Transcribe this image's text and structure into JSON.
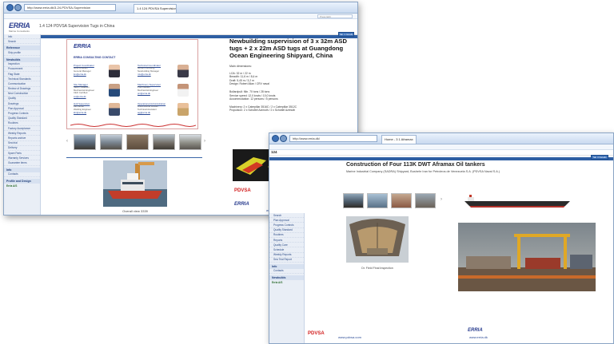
{
  "window_a": {
    "address": "http://www.erria.dk/3-24-PDVSA-Supervision",
    "tab_label": "1.4 124 PDVSA Supervision Tugs in China",
    "search_placeholder": "Press Edit",
    "logo": "ERRIA",
    "logo_sub": "Marine Consultants",
    "page_heading": "1.4 124 PDVSA Supervision Tugs in China",
    "top_button": "Tab 1 Details",
    "sidebar": {
      "top_items": [
        "Info",
        "Search"
      ],
      "section1": "Reference",
      "section1_items": [
        "Ship profile"
      ],
      "section2": "Newbuilds",
      "section2_items": [
        "Inspection",
        "Procurement",
        "Flag State",
        "Technical Standards",
        "Communication",
        "Review of Drawings",
        "New Construction",
        "Quality",
        "Drawings",
        "Plan Approval",
        "Progress Controls",
        "Quality Standard",
        "Routines",
        "Factory Acceptance",
        "Weekly Reports",
        "Reports archive",
        "Sea trial",
        "Delivery",
        "Spare Parts",
        "Warranty Services",
        "Guarantee items"
      ],
      "section3": "Info",
      "section3_items": [
        "Contacts"
      ],
      "section4": "Profile and Design",
      "note": "Erria A/S"
    },
    "contact_card": {
      "logo": "ERRIA",
      "title": "ERRIA CONSULTING CONTACT",
      "contacts": [
        {
          "role": "Project Coordinator",
          "lines": [
            "Jens Knudsen",
            "General Manager"
          ],
          "mail": "jkn@erria.dk"
        },
        {
          "role": "Technical Coordinator",
          "lines": [
            "Morten Lundberg",
            "Newbuilding Manager"
          ],
          "mail": "mlu@erria.dk"
        },
        {
          "role": "Site Manager",
          "lines": [
            "Søren Villadsen",
            "Mechanical Engineer",
            "CEO Certified"
          ],
          "mail": "svi@erria.dk"
        },
        {
          "role": "Machinery Supervisor",
          "lines": [
            "Poul Nielsen",
            "Mechanical Engineer"
          ],
          "mail": "pni@erria.dk"
        },
        {
          "role": "Hull Supervisor",
          "lines": [
            "Kim Bruun",
            "Welding Engineer"
          ],
          "mail": "kbr@erria.dk"
        },
        {
          "role": "Operational Administration",
          "lines": [
            "Anne-Grethe Jensen",
            "Technical Assistant"
          ],
          "mail": "agj@erria.dk"
        }
      ]
    },
    "photo_caption": "Overall view 3339",
    "article": {
      "title": "Newbuilding supervision of 3 x 32m ASD tugs + 2 x 22m ASD tugs at Guangdong Ocean Engineering Shipyard, China",
      "main_dim_heading": "Main dimensions:",
      "lines_1": [
        "LOA: 32 m / 22 m",
        "Breadth: 11,6 m / 8,4 m",
        "Draft: 5,45 m / 3,2 m",
        "Design: Robert Allan / CRV naval"
      ],
      "lines_2": [
        "Bollardpull: Min. 70 tons / 28 tons",
        "Service speed: 12,0 knots / 10,0 knots",
        "Accommodation: 12 persons / 5 persons"
      ],
      "lines_3": [
        "Machinery: 2 x Caterpillar 3516C / 2 x Caterpillar 3512C",
        "Propulsion: 2 x Schottel Azimuth / 2 x Schottel Azimuth"
      ],
      "pdvsa": "PDVSA",
      "pdvsa_link": "www.pdvsa.com",
      "erria": "ERRIA",
      "erria_link": "www.erria.dk"
    }
  },
  "window_b": {
    "address": "http://www.erria.dk/",
    "tab_label": "Home - 3 1 Aframax",
    "top_button": "Tab 3 Details",
    "section_number": "124",
    "title": "Construction of Four 113K DWT Aframax Oil tankers",
    "subtitle": "Marine Industrial Company (SADRA) Shipyard, Bushehr Iran for Petroleos de Venezuela S.A. (PDVSA Naval S.A.)",
    "caption": "Dr. Field Final Inspection",
    "sidebar": {
      "items": [
        "Search",
        "Plan Approval",
        "Progress Controls",
        "Quality Standard",
        "Routines",
        "Reports",
        "Quality Care",
        "Schedule",
        "Weekly Reports",
        "Sea Trial Report"
      ],
      "section": "Info",
      "section_items": [
        "Contacts"
      ],
      "section2": "Newbuilds",
      "note": "Erria A/S"
    },
    "pdvsa": "PDVSA",
    "pdvsa_link": "www.pdvsa.com",
    "erria": "ERRIA",
    "erria_link": "www.erria.dk"
  }
}
